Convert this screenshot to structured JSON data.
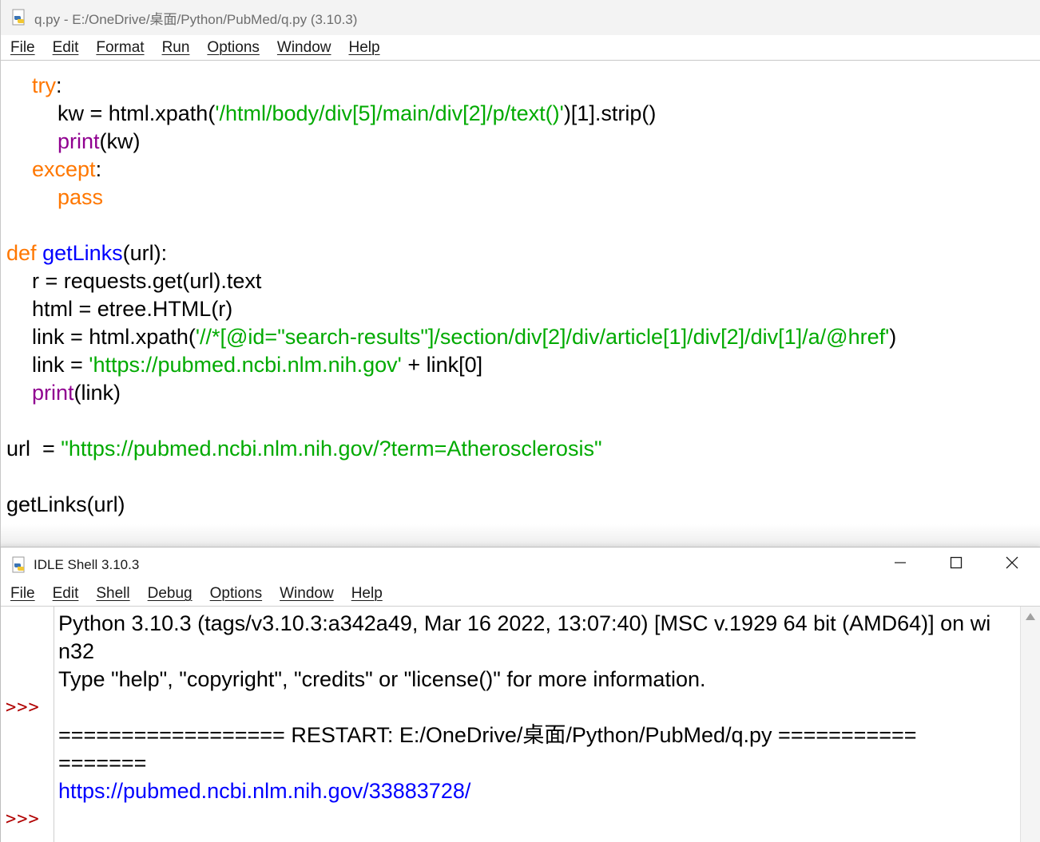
{
  "editor": {
    "title": "q.py - E:/OneDrive/桌面/Python/PubMed/q.py (3.10.3)",
    "menu": [
      "File",
      "Edit",
      "Format",
      "Run",
      "Options",
      "Window",
      "Help"
    ],
    "code": {
      "l1_kw": "try",
      "l1_punct": ":",
      "l2_a": "kw = html.xpath(",
      "l2_str": "'/html/body/div[5]/main/div[2]/p/text()'",
      "l2_b": ")[1].strip()",
      "l3_bi": "print",
      "l3_rest": "(kw)",
      "l4_kw": "except",
      "l4_punct": ":",
      "l5_kw": "pass",
      "l7_kw": "def",
      "l7_space": " ",
      "l7_def": "getLinks",
      "l7_rest": "(url):",
      "l8": "r = requests.get(url).text",
      "l9": "html = etree.HTML(r)",
      "l10_a": "link = html.xpath(",
      "l10_str": "'//*[@id=\"search-results\"]/section/div[2]/div/article[1]/div[2]/div[1]/a/@href'",
      "l10_b": ")",
      "l11_a": "link = ",
      "l11_str": "'https://pubmed.ncbi.nlm.nih.gov'",
      "l11_b": " + link[0]",
      "l12_bi": "print",
      "l12_rest": "(link)",
      "l14_a": "url  = ",
      "l14_str": "\"https://pubmed.ncbi.nlm.nih.gov/?term=Atherosclerosis\"",
      "l16": "getLinks(url)"
    }
  },
  "shell": {
    "title": "IDLE Shell 3.10.3",
    "menu": [
      "File",
      "Edit",
      "Shell",
      "Debug",
      "Options",
      "Window",
      "Help"
    ],
    "prompt": ">>>",
    "lines": {
      "banner1": "Python 3.10.3 (tags/v3.10.3:a342a49, Mar 16 2022, 13:07:40) [MSC v.1929 64 bit (AMD64)] on wi",
      "banner2": "n32",
      "banner3": "Type \"help\", \"copyright\", \"credits\" or \"license()\" for more information.",
      "restart1": "================== RESTART: E:/OneDrive/桌面/Python/PubMed/q.py ===========",
      "restart2": "=======",
      "output": "https://pubmed.ncbi.nlm.nih.gov/33883728/"
    }
  },
  "colors": {
    "keyword": "#ff7700",
    "builtin": "#900090",
    "string": "#00aa00",
    "definition": "#0000ff",
    "prompt": "#b00000",
    "stdout_link": "#0000ff"
  },
  "icons": [
    "python-file-icon",
    "minimize-icon",
    "maximize-icon",
    "close-icon",
    "scroll-up-arrow-icon"
  ]
}
